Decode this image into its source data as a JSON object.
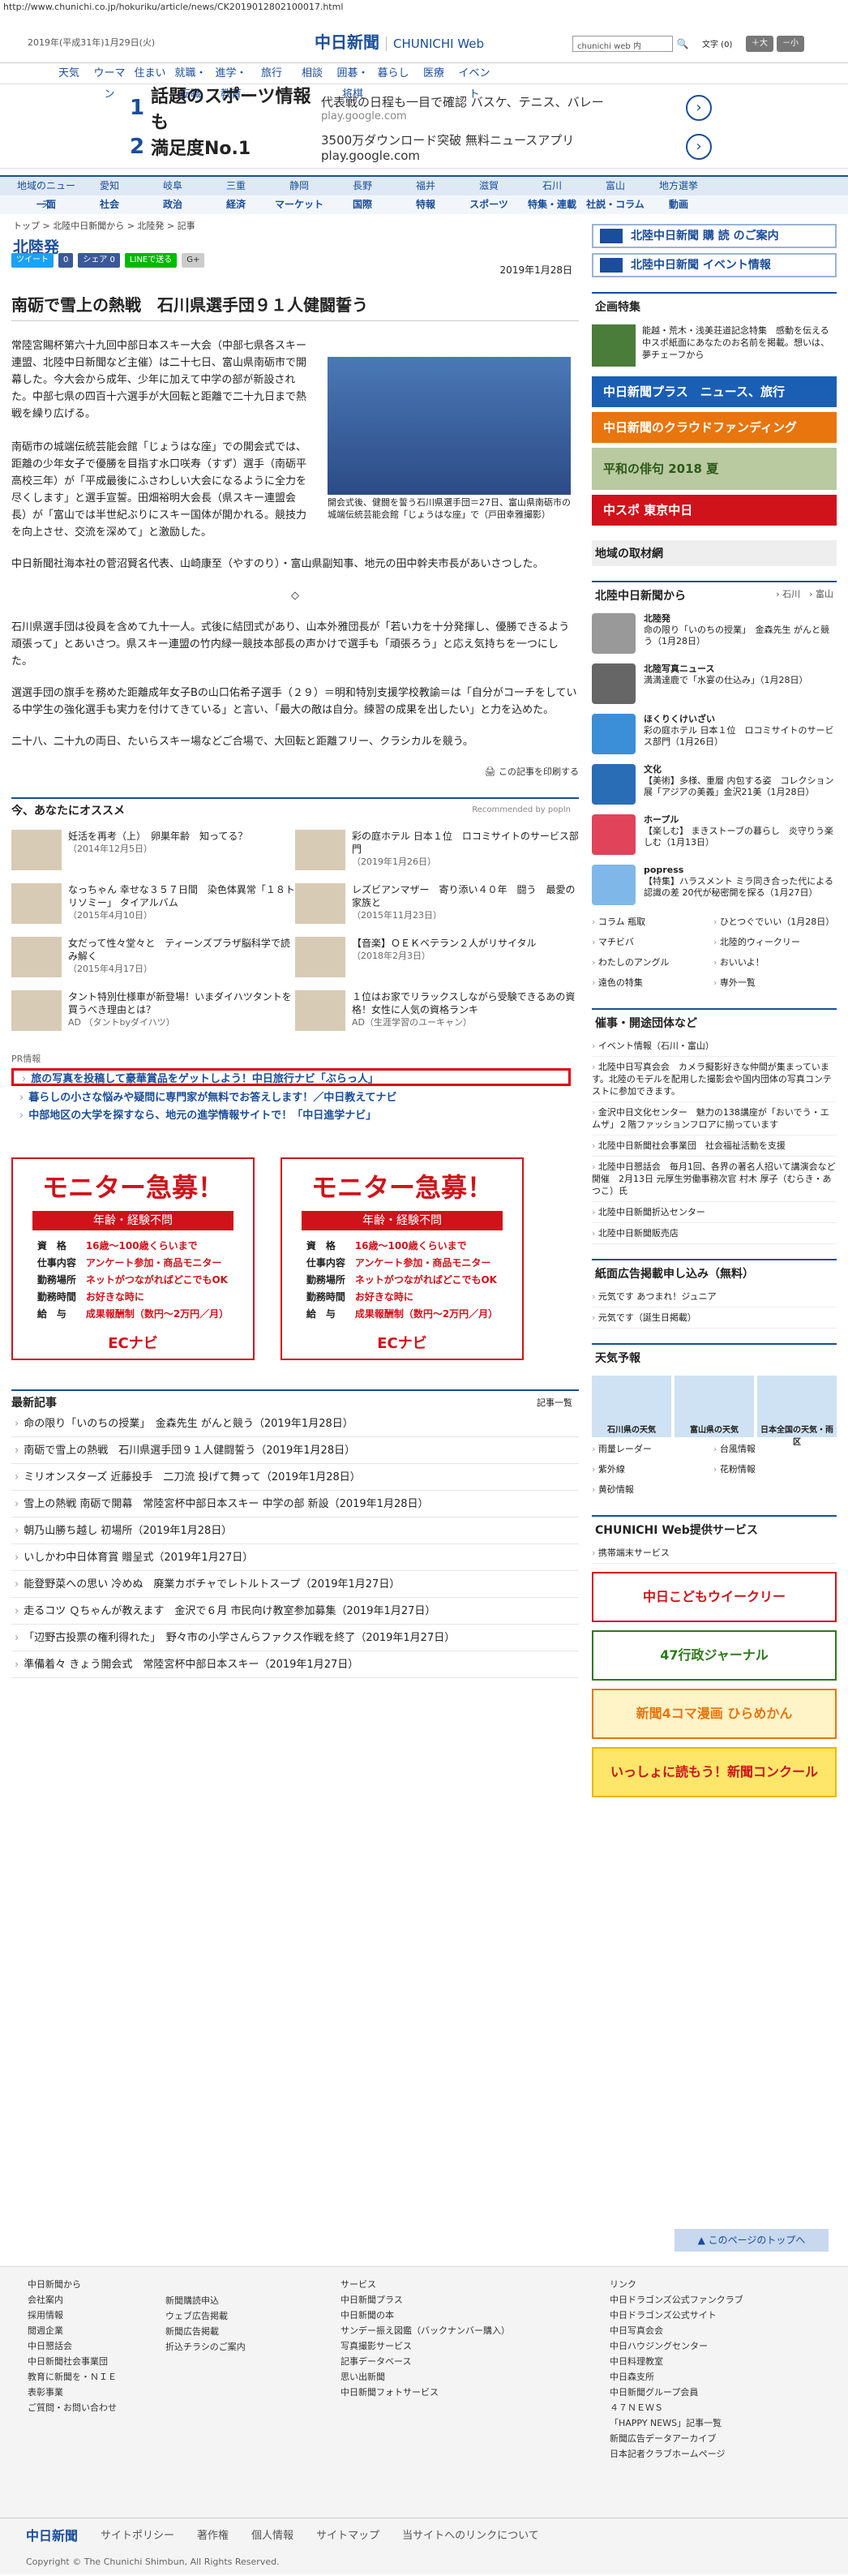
{
  "url": "http://www.chunichi.co.jp/hokuriku/article/news/CK2019012802100017.html",
  "header": {
    "date": "2019年(平成31年)1月29日(火)",
    "logo": "中日新聞",
    "logo_sub": "CHUNICHI Web",
    "search_placeholder": "chunichi web 内",
    "font_label": "文字 (0)",
    "font_bigger": "大",
    "font_smaller": "小",
    "nav": [
      "天気",
      "ウーマン",
      "住まい",
      "就職・転職",
      "進学・教育",
      "旅行",
      "相談",
      "囲碁・将棋",
      "暮らし",
      "医療",
      "イベント"
    ]
  },
  "ads": [
    {
      "num": "1",
      "headline": "話題のスポーツ情報も",
      "desc": "代表戦の日程も一目で確認 バスケ、テニス、バレー",
      "site": "play.google.com"
    },
    {
      "num": "2",
      "headline": "満足度No.1",
      "desc": "3500万ダウンロード突破 無料ニュースアプリ play.google.com",
      "site": ""
    }
  ],
  "secnav": {
    "row1": [
      "地域のニュース",
      "愛知",
      "岐阜",
      "三重",
      "静岡",
      "長野",
      "福井",
      "滋賀",
      "石川",
      "富山",
      "地方選挙"
    ],
    "row2": [
      "一面",
      "社会",
      "政治",
      "経済",
      "マーケット",
      "国際",
      "スポーツ",
      "特集・連載",
      "社説・コラム",
      "動画"
    ],
    "row2b": [
      "特報"
    ]
  },
  "breadcrumb": "トップ > 北陸中日新聞から > 北陸発 > 記事",
  "section_title": "北陸発",
  "share": [
    "ツイート",
    "0",
    "シェア 0",
    "LINEで送る",
    "G+"
  ],
  "article": {
    "date": "2019年1月28日",
    "title": "南砺で雪上の熱戦　石川県選手団９１人健闘誓う",
    "caption": "開会式後、健闘を誓う石川県選手団＝27日、富山県南砺市の城端伝統芸能会館「じょうはな座」で（戸田幸雅撮影）",
    "p1": "常陸宮賜杯第六十九回中部日本スキー大会（中部七県各スキー連盟、北陸中日新聞など主催）は二十七日、富山県南砺市で開幕した。今大会から成年、少年に加えて中学の部が新設された。中部七県の四百十六選手が大回転と距離で二十九日まで熱戦を繰り広げる。",
    "p2": "南砺市の城端伝統芸能会館「じょうはな座」での開会式では、距離の少年女子で優勝を目指す水口咲寿（すず）選手（南砺平高校三年）が「平成最後にふさわしい大会になるように全力を尽くします」と選手宣誓。田畑裕明大会長（県スキー連盟会長）が「富山では半世紀ぶりにスキー国体が開かれる。競技力を向上させ、交流を深めて」と激励した。",
    "p3": "中日新聞社海本社の菅沼賢名代表、山崎康至（やすのり）・富山県副知事、地元の田中幹夫市長があいさつした。",
    "sep": "◇",
    "p4": "石川県選手団は役員を含めて九十一人。式後に結団式があり、山本外雅団長が「若い力を十分発揮し、優勝できるよう頑張って」とあいさつ。県スキー連盟の竹内緑一競技本部長の声かけで選手も「頑張ろう」と応え気持ちを一つにした。",
    "p5": "選選手団の旗手を務めた距離成年女子Bの山口佑希子選手（２９）＝明和特別支援学校教諭＝は「自分がコーチをしている中学生の強化選手も実力を付けてきている」と言い、「最大の敵は自分。練習の成果を出したい」と力を込めた。",
    "p6": "二十八、二十九の両日、たいらスキー場などご合場で、大回転と距離フリー、クラシカルを競う。",
    "print": "この記事を印刷する"
  },
  "recommend": {
    "title": "今、あなたにオススメ",
    "credit": "Recommended by popIn",
    "items": [
      {
        "t": "妊活を再考（上）　卵巣年齢　知ってる？",
        "d": "（2014年12月5日）"
      },
      {
        "t": "彩の庭ホテル 日本１位　ロコミサイトのサービス部門",
        "d": "（2019年1月26日）"
      },
      {
        "t": "なっちゃん 幸せな３５７日間　染色体異常「１８トリソミー」 タイアルバム",
        "d": "（2015年4月10日）"
      },
      {
        "t": "レズビアンマザー　寄り添い４０年　闘う　最愛の家族と",
        "d": "（2015年11月23日）"
      },
      {
        "t": "女だって性々堂々と　ティーンズプラザ脳科学で読み解く",
        "d": "（2015年4月17日）"
      },
      {
        "t": "【音楽】ＯＥＫベテラン２人がリサイタル",
        "d": "（2018年2月3日）"
      },
      {
        "t": "タント特別仕様車が新登場！いまダイハツタントを買うべき理由とは？",
        "d": "AD （タントbyダイハツ）"
      },
      {
        "t": "１位はお家でリラックスしながら受験できるあの資格！女性に人気の資格ランキ",
        "d": "AD（生涯学習のユーキャン）"
      }
    ]
  },
  "pr": {
    "label": "PR情報",
    "lines": [
      "旅の写真を投稿して豪華賞品をゲットしよう！中日旅行ナビ「ぶらっ人」",
      "暮らしの小さな悩みや疑問に専門家が無料でお答えします！／中日教えてナビ",
      "中部地区の大学を探すなら、地元の進学情報サイトで！「中日進学ナビ」"
    ]
  },
  "monitor": {
    "title": "モニター急募！",
    "bar": "年齢・経験不問",
    "rows": [
      [
        "資　格",
        "16歳～100歳くらいまで"
      ],
      [
        "仕事内容",
        "アンケート参加・商品モニター"
      ],
      [
        "勤務場所",
        "ネットがつながればどこでもOK"
      ],
      [
        "勤務時間",
        "お好きな時に"
      ],
      [
        "給　与",
        "成果報酬制（数円～2万円／月）"
      ]
    ],
    "brand": "ECナビ"
  },
  "latest": {
    "title": "最新記事",
    "more": "記事一覧",
    "items": [
      "命の限り「いのちの授業」　金森先生 がんと競う（2019年1月28日）",
      "南砺で雪上の熱戦　石川県選手団９１人健闘誓う（2019年1月28日）",
      "ミリオンスターズ 近藤投手　二刀流 投げて舞って（2019年1月28日）",
      "雪上の熱戦 南砺で開幕　常陸宮杯中部日本スキー 中学の部 新設（2019年1月28日）",
      "朝乃山勝ち越し 初場所（2019年1月28日）",
      "いしかわ中日体育賞 贈呈式（2019年1月27日）",
      "能登野菜への思い 冷めぬ　廃業カボチャでレトルトスープ（2019年1月27日）",
      "走るコツ Ｑちゃんが教えます　金沢で６月 市民向け教室参加募集（2019年1月27日）",
      "「辺野古投票の権利得れた」　野々市の小学さんらファクス作戦を終了（2019年1月27日）",
      "準備着々 きょう開会式　常陸宮杯中部日本スキー（2019年1月27日）"
    ]
  },
  "side": {
    "btn1": "北陸中日新聞 購 読 のご案内",
    "btn2": "北陸中日新聞 イベント情報",
    "kikaku_title": "企画特集",
    "kikaku": "能越・荒木・浅美荘道記念特集　感動を伝える中スポ紙面にあなたのお名前を掲載。想いは、夢チェーフから",
    "banners": [
      "中日新聞プラス　ニュース、旅行",
      "中日新聞のクラウドファンディング",
      "平和の俳句 2018 夏",
      "中スポ 東京中日"
    ],
    "local": "地域の取材網",
    "from_title": "北陸中日新聞から",
    "from_links": [
      "石川",
      "富山"
    ],
    "from": [
      {
        "h": "北陸発",
        "t": "命の限り「いのちの授業」　金森先生 がんと競う（1月28日）"
      },
      {
        "h": "北陸写真ニュース",
        "t": "満満達鹿で「水宴の仕込み」（1月28日）"
      },
      {
        "h": "ほくりくけいざい",
        "t": "彩の庭ホテル 日本１位　ロコミサイトのサービス部門（1月26日）"
      },
      {
        "h": "文化",
        "t": "【美術】多様、重層 内包する姿　コレクション展「アジアの美義」金沢21美（1月28日）"
      },
      {
        "h": "ホープル",
        "t": "【楽しむ】 まきストーブの暮らし　炎守りう楽しむ（1月13日）"
      },
      {
        "h": "popress",
        "t": "【特集】ハラスメント ミラ同き合った代による認識の差 20代が秘密開を探る（1月27日）"
      }
    ],
    "links2": [
      "コラム 瓶取",
      "ひとつぐでいい（1月28日）",
      "マチビバ",
      "北陸的ウィークリー",
      "わたしのアングル",
      "おいいよ！",
      "遠色の特集",
      "専外一覧"
    ],
    "event_title": "催事・開途団体など",
    "event_sub": "イベント情報（石川・富山）",
    "events": [
      "北陸中日写真会会　カメラ擬影好きな仲間が集まっています。北陸のモデルを配用した撮影会や国内団体の写真コンテストに参加できます。",
      "金沢中日文化センター　魅力の138講座が「おいでう・エムザ」２階ファッションフロアに揃っています",
      "北陸中日新聞社会事業団　社会福祉活動を支援",
      "北陸中日懇話会　毎月1回、各界の著名人招いて講演会など開催　2月13日 元厚生労働事務次官 村木 厚子（むらき・あつこ）氏",
      "北陸中日新聞折込センター",
      "北陸中日新聞販売店"
    ],
    "koukoku_title": "紙面広告掲載申し込み（無料）",
    "koukoku": [
      "元気です あつまれ！ジュニア",
      "元気です（誕生日掲載）"
    ],
    "weather_title": "天気予報",
    "weather": [
      "石川県の天気",
      "富山県の天気",
      "日本全国の天気・雨区"
    ],
    "w_links": [
      "雨量レーダー",
      "台風情報",
      "紫外線",
      "花粉情報",
      "黄砂情報"
    ],
    "svc_title": "CHUNICHI Web提供サービス",
    "svc": "携帯端末サービス",
    "sb": [
      "中日こどもウイークリー",
      "47行政ジャーナル",
      "新聞4コマ漫画 ひらめかん",
      "いっしょに読もう！新聞コンクール"
    ]
  },
  "pagetop": "このページのトップへ",
  "footer": {
    "c1": [
      "中日新聞から",
      "会社案内",
      "採用情報",
      "閲週企業",
      "中日懇話会",
      "中日新聞社会事業団",
      "教育に新聞を・ＮＩＥ",
      "表彰事業",
      "ご質問・お問い合わせ"
    ],
    "c2": [
      "新聞購読申込",
      "ウェブ広告掲載",
      "新聞広告掲載",
      "折込チラシのご案内"
    ],
    "c3": [
      "サービス",
      "中日新聞プラス",
      "中日新聞の本",
      "サンデー振え図鑑（バックナンバー購入）",
      "写真撮影サービス",
      "記事データベース",
      "思い出新聞",
      "中日新聞フォトサービス"
    ],
    "c4": [
      "リンク",
      "中日ドラゴンズ公式ファンクラブ",
      "中日ドラゴンズ公式サイト",
      "中日写真会会",
      "中日ハウジングセンター",
      "中日料理教室",
      "中日森支所",
      "中日新聞グループ会員",
      "４７ＮＥＷＳ",
      "「HAPPY NEWS」記事一覧",
      "新聞広告データアーカイブ",
      "日本記者クラブホームページ"
    ],
    "bar": [
      "中日新聞",
      "サイトポリシー",
      "著作権",
      "個人情報",
      "サイトマップ",
      "当サイトへのリンクについて"
    ],
    "copyright": "Copyright © The Chunichi Shimbun, All Rights Reserved."
  }
}
